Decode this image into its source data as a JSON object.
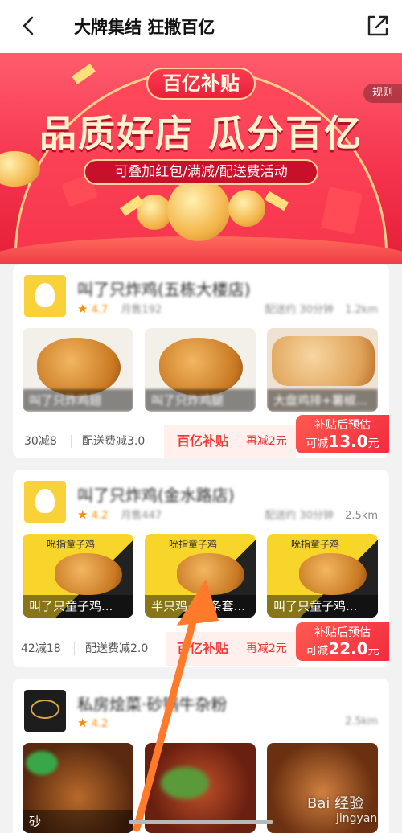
{
  "header": {
    "title": "大牌集结 狂撒百亿",
    "back_icon": "chevron-left-icon",
    "share_icon": "share-icon"
  },
  "banner": {
    "tag": "百亿补贴",
    "headline": "品质好店 瓜分百亿",
    "subline": "可叠加红包/满减/配送费活动",
    "rules": "规则"
  },
  "stores": [
    {
      "name": "叫了只炸鸡(五栋大楼店)",
      "rating": "4.7",
      "monthly_sales": "月售192",
      "delivery": "配送约 30分钟",
      "distance": "1.2km",
      "photo_captions": [
        "叫了只炸鸡翅",
        "叫了只炸鸡腿",
        "大盘鸡排+薯椒..."
      ],
      "promos": [
        "30减8",
        "配送费减3.0"
      ],
      "subsidy_label": "百亿补贴",
      "extra_discount": "再减2元",
      "after_label": "补贴后预估",
      "after_prefix": "可减",
      "after_amount": "13.0",
      "after_unit": "元"
    },
    {
      "name": "叫了只炸鸡(金水路店)",
      "rating": "4.2",
      "monthly_sales": "月售447",
      "delivery": "配送约 30分钟",
      "distance": "2.5km",
      "photo_captions": [
        "叫了只童子鸡...",
        "半只鸡+薯条套...",
        "叫了只童子鸡..."
      ],
      "photo_top_text": "吮指童子鸡",
      "promos": [
        "42减18",
        "配送费减2.0"
      ],
      "subsidy_label": "百亿补贴",
      "extra_discount": "再减2元",
      "after_label": "补贴后预估",
      "after_prefix": "可减",
      "after_amount": "22.0",
      "after_unit": "元"
    },
    {
      "name": "私房烩菜·砂锅牛杂粉",
      "rating": "4.2",
      "distance": "2.5km",
      "photo_captions": [
        "砂"
      ]
    }
  ],
  "watermark": {
    "brand": "Bai 经验",
    "sub": "jingyan"
  }
}
